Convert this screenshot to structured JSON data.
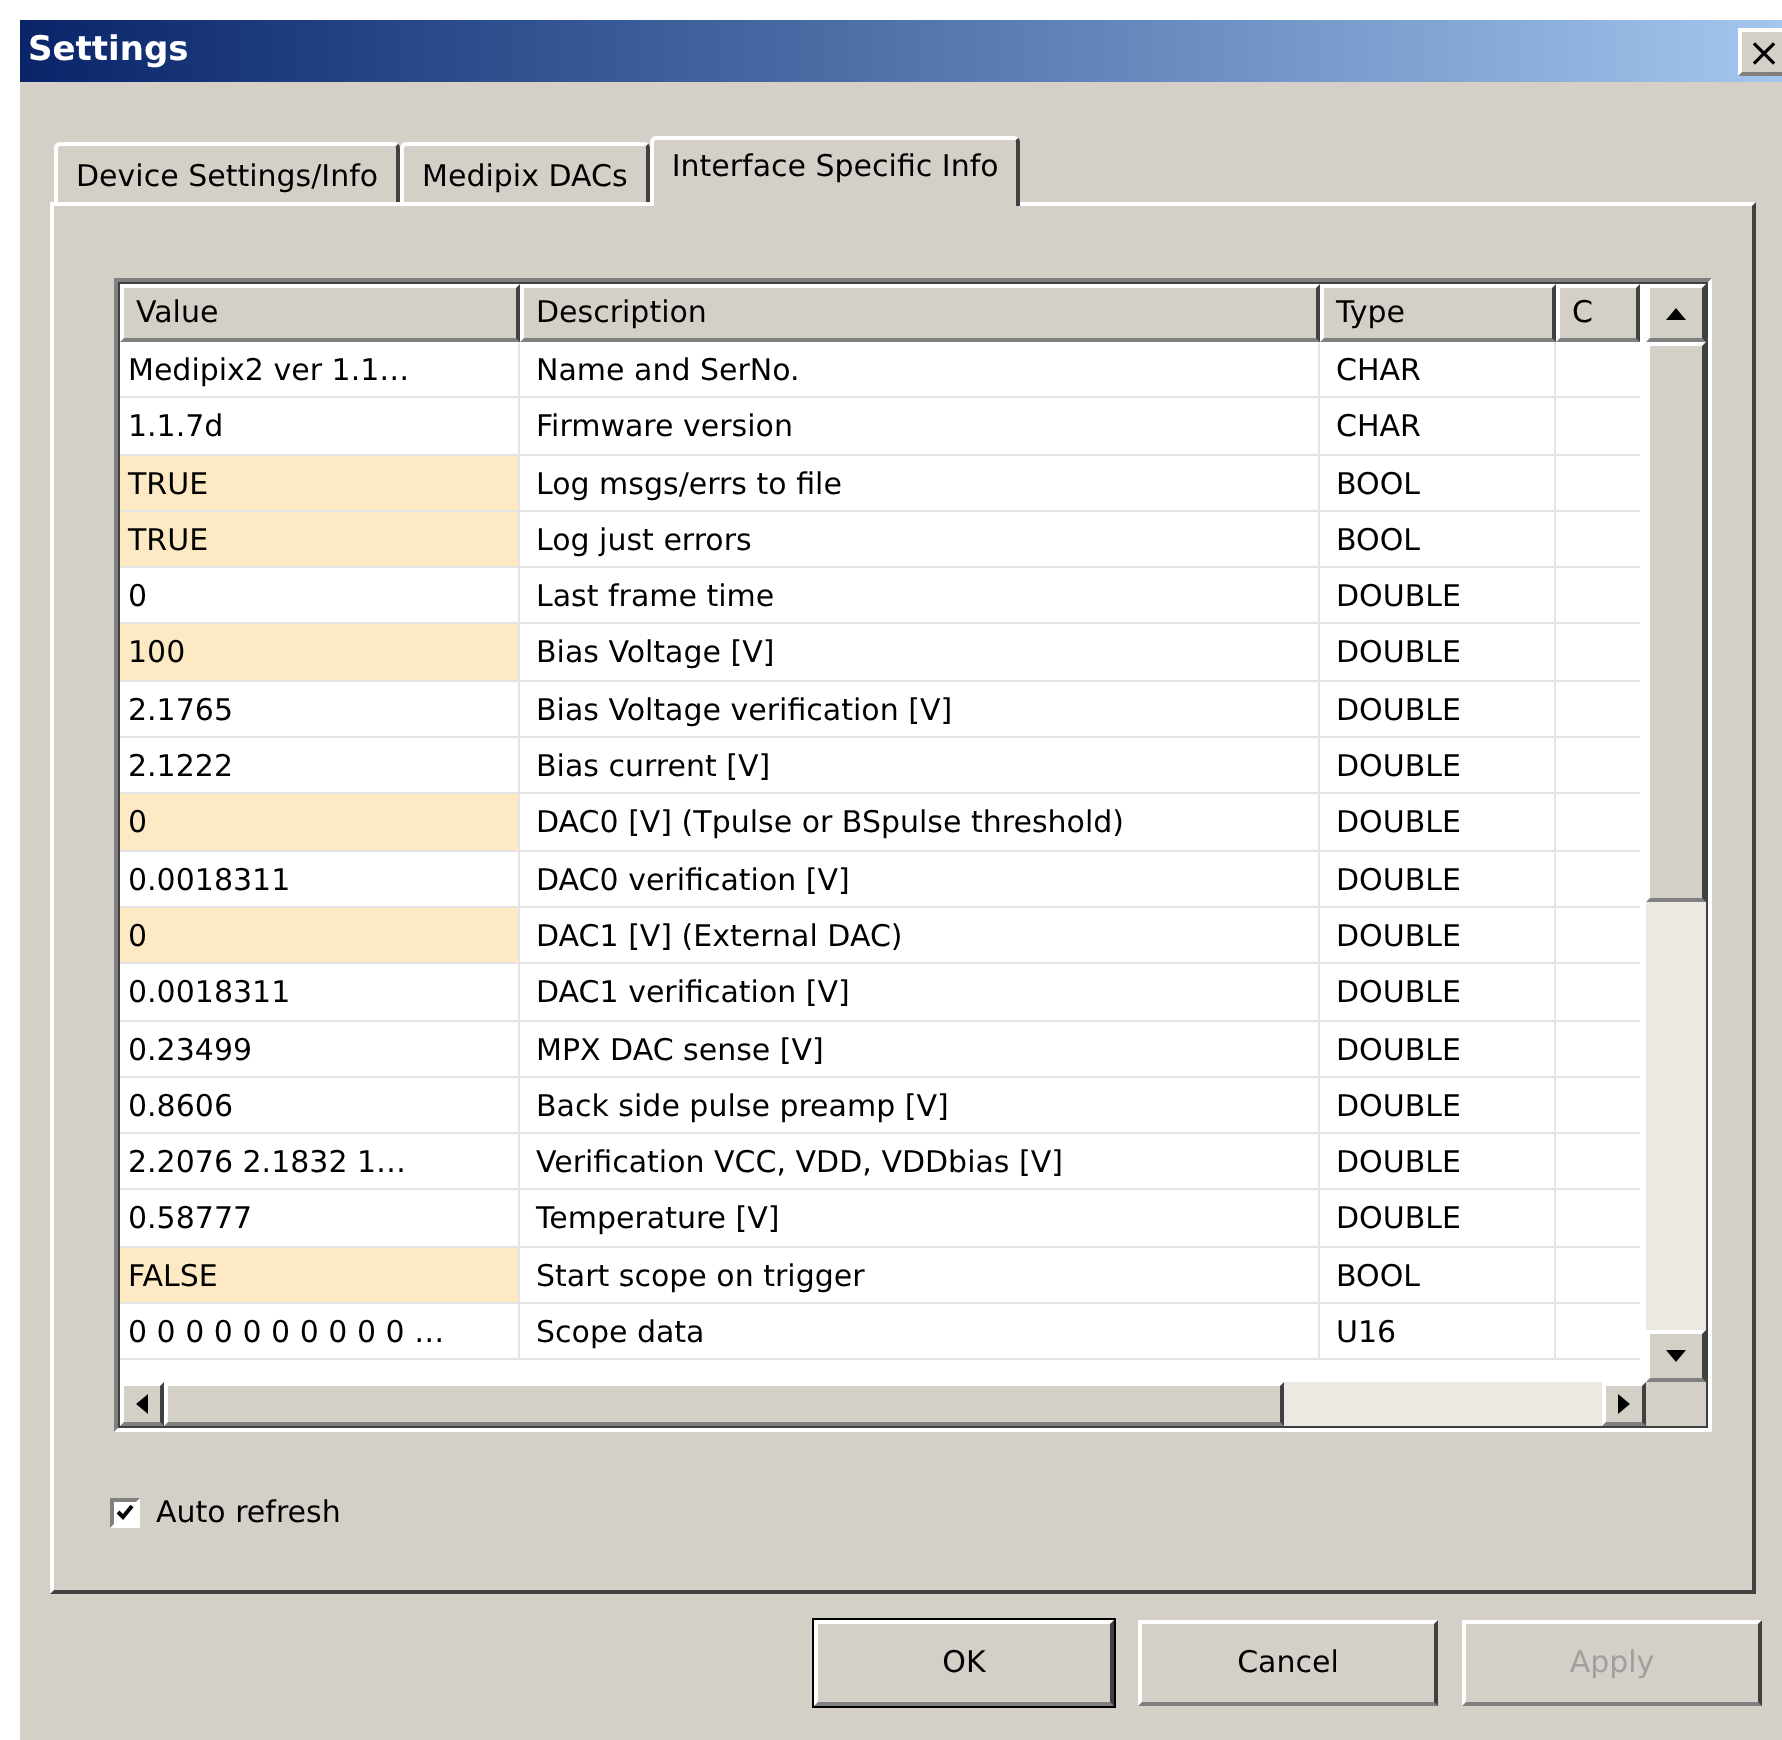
{
  "window": {
    "title": "Settings",
    "close": "×"
  },
  "tabs": [
    {
      "label": "Device Settings/Info",
      "selected": false
    },
    {
      "label": "Medipix DACs",
      "selected": false
    },
    {
      "label": "Interface Specific Info",
      "selected": true
    }
  ],
  "table": {
    "columns": [
      "Value",
      "Description",
      "Type",
      "C"
    ],
    "rows": [
      {
        "value": "Medipix2 ver 1.1…",
        "description": "Name and SerNo.",
        "type": "CHAR",
        "editable": false
      },
      {
        "value": "1.1.7d",
        "description": "Firmware version",
        "type": "CHAR",
        "editable": false
      },
      {
        "value": "TRUE",
        "description": "Log msgs/errs to file",
        "type": "BOOL",
        "editable": true
      },
      {
        "value": "TRUE",
        "description": "Log just errors",
        "type": "BOOL",
        "editable": true
      },
      {
        "value": "0",
        "description": "Last frame time",
        "type": "DOUBLE",
        "editable": false
      },
      {
        "value": "100",
        "description": "Bias Voltage [V]",
        "type": "DOUBLE",
        "editable": true
      },
      {
        "value": "2.1765",
        "description": "Bias Voltage verification [V]",
        "type": "DOUBLE",
        "editable": false
      },
      {
        "value": "2.1222",
        "description": "Bias current [V]",
        "type": "DOUBLE",
        "editable": false
      },
      {
        "value": "0",
        "description": "DAC0 [V] (Tpulse or BSpulse threshold)",
        "type": "DOUBLE",
        "editable": true
      },
      {
        "value": "0.0018311",
        "description": "DAC0 verification [V]",
        "type": "DOUBLE",
        "editable": false
      },
      {
        "value": "0",
        "description": "DAC1 [V] (External DAC)",
        "type": "DOUBLE",
        "editable": true
      },
      {
        "value": "0.0018311",
        "description": "DAC1 verification [V]",
        "type": "DOUBLE",
        "editable": false
      },
      {
        "value": "0.23499",
        "description": "MPX DAC sense [V]",
        "type": "DOUBLE",
        "editable": false
      },
      {
        "value": "0.8606",
        "description": "Back side pulse preamp [V]",
        "type": "DOUBLE",
        "editable": false
      },
      {
        "value": "2.2076 2.1832 1…",
        "description": "Verification VCC, VDD, VDDbias [V]",
        "type": "DOUBLE",
        "editable": false
      },
      {
        "value": "0.58777",
        "description": "Temperature [V]",
        "type": "DOUBLE",
        "editable": false
      },
      {
        "value": "FALSE",
        "description": "Start scope on trigger",
        "type": "BOOL",
        "editable": true
      },
      {
        "value": "0 0 0 0 0 0 0 0 0 0 …",
        "description": "Scope data",
        "type": "U16",
        "editable": false
      }
    ]
  },
  "auto_refresh": {
    "label": "Auto refresh",
    "checked": true
  },
  "buttons": [
    {
      "label": "OK",
      "default": true,
      "disabled": false
    },
    {
      "label": "Cancel",
      "default": false,
      "disabled": false
    },
    {
      "label": "Apply",
      "default": false,
      "disabled": true
    }
  ]
}
